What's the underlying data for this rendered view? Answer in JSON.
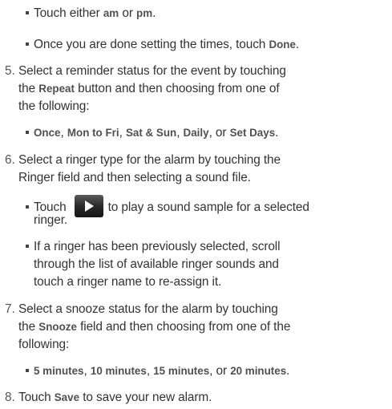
{
  "lines": [
    {
      "text": [
        "Touch either ",
        {
          "kw": "am"
        },
        " or ",
        {
          "kw": "pm"
        },
        "."
      ]
    },
    {
      "text": [
        "Once you are done setting the times, touch ",
        {
          "kw": "Done"
        },
        "."
      ]
    },
    {
      "text": [
        "Select a reminder status for the event by touching"
      ]
    },
    {
      "text": [
        "the ",
        {
          "kw": "Repeat"
        },
        " button and then choosing from one of"
      ]
    },
    {
      "text": [
        "the following:"
      ]
    },
    {
      "text": [
        {
          "kw": "Once"
        },
        ", ",
        {
          "kw": "Mon to Fri"
        },
        ", ",
        {
          "kw": "Sat & Sun"
        },
        ", ",
        {
          "kw": "Daily"
        },
        ", or ",
        {
          "kw": "Set Days"
        },
        "."
      ]
    },
    {
      "text": [
        "Select a ringer type for the alarm by touching the"
      ]
    },
    {
      "text": [
        "Ringer field and then selecting a sound file."
      ]
    },
    {
      "text": [
        "Touch",
        {
          "icon": "play-icon"
        },
        "to play a sound sample for a selected"
      ]
    },
    {
      "text": [
        "ringer."
      ]
    },
    {
      "text": [
        "If a ringer has been previously selected, scroll"
      ]
    },
    {
      "text": [
        "through the list of available ringer sounds and"
      ]
    },
    {
      "text": [
        "touch a ringer name to re-assign it."
      ]
    },
    {
      "text": [
        "Select a snooze status for the alarm by touching"
      ]
    },
    {
      "text": [
        "the ",
        {
          "kw": "Snooze"
        },
        " field and then choosing from one of the"
      ]
    },
    {
      "text": [
        "following:"
      ]
    },
    {
      "text": [
        {
          "kw": "5 minutes"
        },
        ", ",
        {
          "kw": "10 minutes"
        },
        ", ",
        {
          "kw": "15 minutes"
        },
        ", or ",
        {
          "kw": "20 minutes"
        },
        "."
      ]
    },
    {
      "text": [
        "Touch ",
        {
          "kw": "Save"
        },
        " to save your new alarm."
      ]
    }
  ],
  "numbers": {
    "step5": "5.",
    "step6": "6.",
    "step7": "7.",
    "step8": "8."
  },
  "colors": {
    "text": "#333333",
    "keyword": "#505050",
    "number": "#555555"
  },
  "icons": {
    "play": "play-icon"
  }
}
